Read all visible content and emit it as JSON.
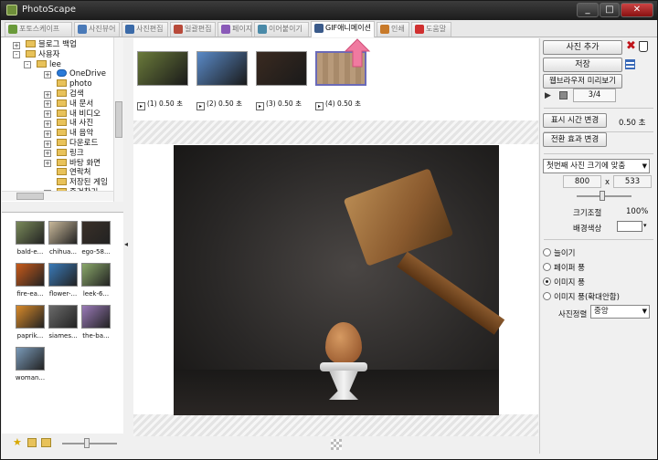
{
  "window": {
    "title": "PhotoScape",
    "controls": [
      "_",
      "□",
      "✕"
    ]
  },
  "tabs": [
    {
      "label": "포토스케이프",
      "icon": "home-icon",
      "color": "#6a9a3a"
    },
    {
      "label": "사진뷰어",
      "icon": "viewer-icon",
      "color": "#4a7ab8"
    },
    {
      "label": "사진편집",
      "icon": "editor-icon",
      "color": "#3a6aa8"
    },
    {
      "label": "일괄편집",
      "icon": "batch-icon",
      "color": "#b84a3a"
    },
    {
      "label": "페이지",
      "icon": "page-icon",
      "color": "#8a5ab8"
    },
    {
      "label": "이어붙이기",
      "icon": "combine-icon",
      "color": "#4a8aa8"
    },
    {
      "label": "GIF애니메이션",
      "icon": "gif-icon",
      "color": "#3a5a8a",
      "active": true
    },
    {
      "label": "인쇄",
      "icon": "print-icon",
      "color": "#c87a2a"
    },
    {
      "label": "도움말",
      "icon": "help-icon",
      "color": "#d03030"
    }
  ],
  "tree": {
    "nodes": [
      {
        "label": "블로그 백업",
        "lvl": 1,
        "exp": "+"
      },
      {
        "label": "사용자",
        "lvl": 1,
        "exp": "-"
      },
      {
        "label": "lee",
        "lvl": 2,
        "exp": "-"
      },
      {
        "label": "OneDrive",
        "lvl": 3,
        "exp": "+",
        "icon": "cloud-icon"
      },
      {
        "label": "photo",
        "lvl": 3,
        "exp": ""
      },
      {
        "label": "검색",
        "lvl": 3,
        "exp": "+"
      },
      {
        "label": "내 문서",
        "lvl": 3,
        "exp": "+"
      },
      {
        "label": "내 비디오",
        "lvl": 3,
        "exp": "+"
      },
      {
        "label": "내 사진",
        "lvl": 3,
        "exp": "+"
      },
      {
        "label": "내 음악",
        "lvl": 3,
        "exp": "+"
      },
      {
        "label": "다운로드",
        "lvl": 3,
        "exp": "+"
      },
      {
        "label": "링크",
        "lvl": 3,
        "exp": "+"
      },
      {
        "label": "바탕 화면",
        "lvl": 3,
        "exp": "+"
      },
      {
        "label": "연락처",
        "lvl": 3,
        "exp": ""
      },
      {
        "label": "저장된 게임",
        "lvl": 3,
        "exp": ""
      },
      {
        "label": "즐겨찾기",
        "lvl": 3,
        "exp": "+"
      }
    ]
  },
  "thumbnails": [
    {
      "label": "bald-e...",
      "color": "#7a8a5a"
    },
    {
      "label": "chihua...",
      "color": "#c8b89a"
    },
    {
      "label": "ego-58...",
      "color": "#3a3028"
    },
    {
      "label": "fire-ea...",
      "color": "#c85a1a"
    },
    {
      "label": "flower-...",
      "color": "#3a7ab8"
    },
    {
      "label": "leek-6...",
      "color": "#8aa86a"
    },
    {
      "label": "paprik...",
      "color": "#d88a2a"
    },
    {
      "label": "siames...",
      "color": "#6a6a6a"
    },
    {
      "label": "the-ba...",
      "color": "#9a7ab8"
    },
    {
      "label": "woman...",
      "color": "#7a9ab8"
    }
  ],
  "frames": [
    {
      "time": "(1) 0.50 초",
      "color": "#6a7a3a"
    },
    {
      "time": "(2) 0.50 초",
      "color": "#5a8ac8"
    },
    {
      "time": "(3) 0.50 초",
      "color": "#3a2a20"
    },
    {
      "time": "(4) 0.50 초",
      "color": "#b89a7a",
      "selected": true
    }
  ],
  "right": {
    "add_photo": "사진 추가",
    "save": "저장",
    "browser_preview": "웹브라우저 미리보기",
    "frame_counter": "3/4",
    "change_time": "표시 시간 변경",
    "time_value": "0.50 초",
    "change_effect": "전환 효과 변경",
    "size_mode": "첫번째 사진 크기에 맞춤",
    "width": "800",
    "x_sep": "x",
    "height": "533",
    "scale_label": "크기조절",
    "scale_value": "100%",
    "bg_color_label": "배경색상",
    "radio_options": [
      {
        "label": "늘이기",
        "selected": false
      },
      {
        "label": "페이퍼 풍",
        "selected": false
      },
      {
        "label": "이미지 풍",
        "selected": true
      },
      {
        "label": "이미지 풍(확대안함)",
        "selected": false
      }
    ],
    "align_label": "사진정렬",
    "align_value": "중앙"
  },
  "colors": {
    "accent_arrow": "#f07aa0",
    "titlebar": "#2a2a2a"
  }
}
